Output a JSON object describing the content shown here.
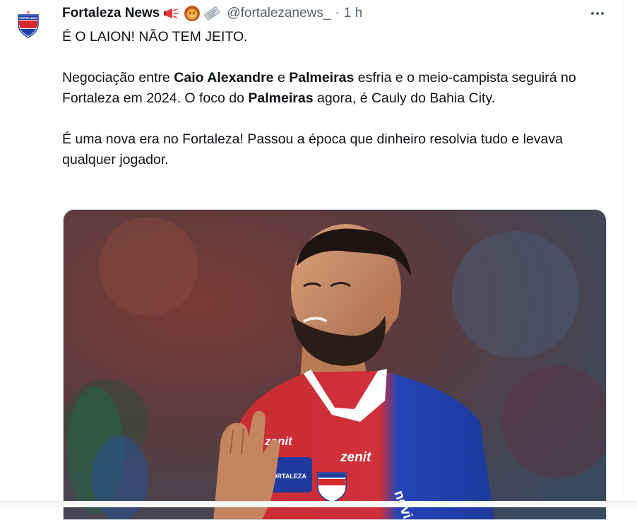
{
  "tweet": {
    "author_name": "Fortaleza News",
    "handle": "@fortalezanews_",
    "separator": "·",
    "time": "1 h",
    "badge_emojis": [
      "megaphone-icon",
      "lion-icon",
      "newspaper-icon"
    ],
    "avatar_text": "FORTALEZA",
    "line1": "É O LAION! NÃO TEM JEITO.",
    "p2_a": "Negociação entre ",
    "p2_b": "Caio Alexandre",
    "p2_c": " e ",
    "p2_d": "Palmeiras",
    "p2_e": " esfria e o meio-campista seguirá no Fortaleza em 2024. O foco do ",
    "p2_f": "Palmeiras",
    "p2_g": " agora, é Cauly do Bahia City.",
    "p3": "É uma nova era no Fortaleza! Passou a época que dinheiro resolvia tudo e levava qualquer jogador.",
    "image_sponsor_1": "zenit",
    "image_sponsor_2": "zenit",
    "image_club_text": "FORTALEZA",
    "image_sleeve_text": "novi"
  },
  "colors": {
    "text": "#0f1419",
    "secondary": "#536471",
    "club_red": "#d62b2b",
    "club_blue": "#1d3fa8"
  }
}
